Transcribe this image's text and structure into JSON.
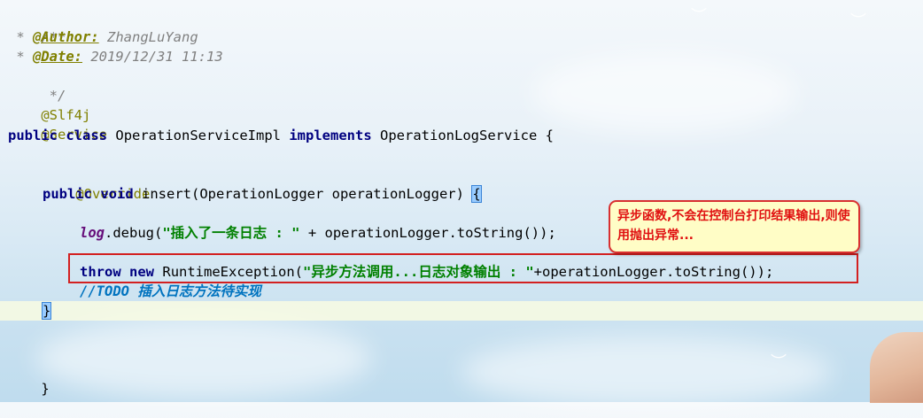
{
  "code": {
    "comment_open": "/**",
    "author_tag": "@Author:",
    "author_value": "ZhangLuYang",
    "date_tag": "@Date:",
    "date_value": "2019/12/31 11:13",
    "comment_close": " */",
    "anno_slf4j": "@Slf4j",
    "anno_service": "@Service",
    "class_kw_public": "public",
    "class_kw_class": "class",
    "class_name": "OperationServiceImpl",
    "class_kw_implements": "implements",
    "class_interface": "OperationLogService {",
    "anno_override": "@Override",
    "method_kw_public": "public",
    "method_kw_void": "void",
    "method_sig": "insert(OperationLogger operationLogger)",
    "method_open_brace": "{",
    "log_field": "log",
    "log_call": ".debug(",
    "log_string": "\"插入了一条日志 : \"",
    "log_rest": " + operationLogger.toString());",
    "throw_kw": "throw",
    "new_kw": "new",
    "exception_call": "RuntimeException(",
    "exception_string": "\"异步方法调用...日志对象输出 : \"",
    "exception_rest": "+operationLogger.toString());",
    "todo_prefix": "//",
    "todo_tag": "TODO",
    "todo_text": " 插入日志方法待实现",
    "method_close_brace": "}",
    "class_close_brace": "}"
  },
  "callout": {
    "text": "异步函数,不会在控制台打印结果输出,则使用抛出异常..."
  },
  "colors": {
    "keyword": "#000080",
    "string": "#008000",
    "annotation": "#808000",
    "comment": "#808080",
    "todo": "#0073bf",
    "highlight_box": "#d32020",
    "callout_bg": "#fffdc6"
  }
}
